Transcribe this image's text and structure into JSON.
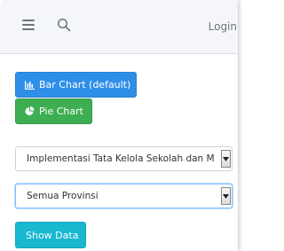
{
  "navbar": {
    "menu_icon": "hamburger-icon",
    "search_icon": "search-icon",
    "login_label": "Login"
  },
  "chart_toggle": {
    "bar_label": "Bar Chart (default)",
    "bar_icon": "bar-chart-icon",
    "pie_label": "Pie Chart",
    "pie_icon": "pie-chart-icon"
  },
  "filters": {
    "program_value": "Implementasi Tata Kelola Sekolah dan M",
    "province_value": "Semua Provinsi"
  },
  "show_button_label": "Show Data",
  "colors": {
    "primary": "#2e8fe8",
    "success": "#3eae53",
    "info": "#19b7d0",
    "navbar_bg": "#f4f6f9"
  }
}
